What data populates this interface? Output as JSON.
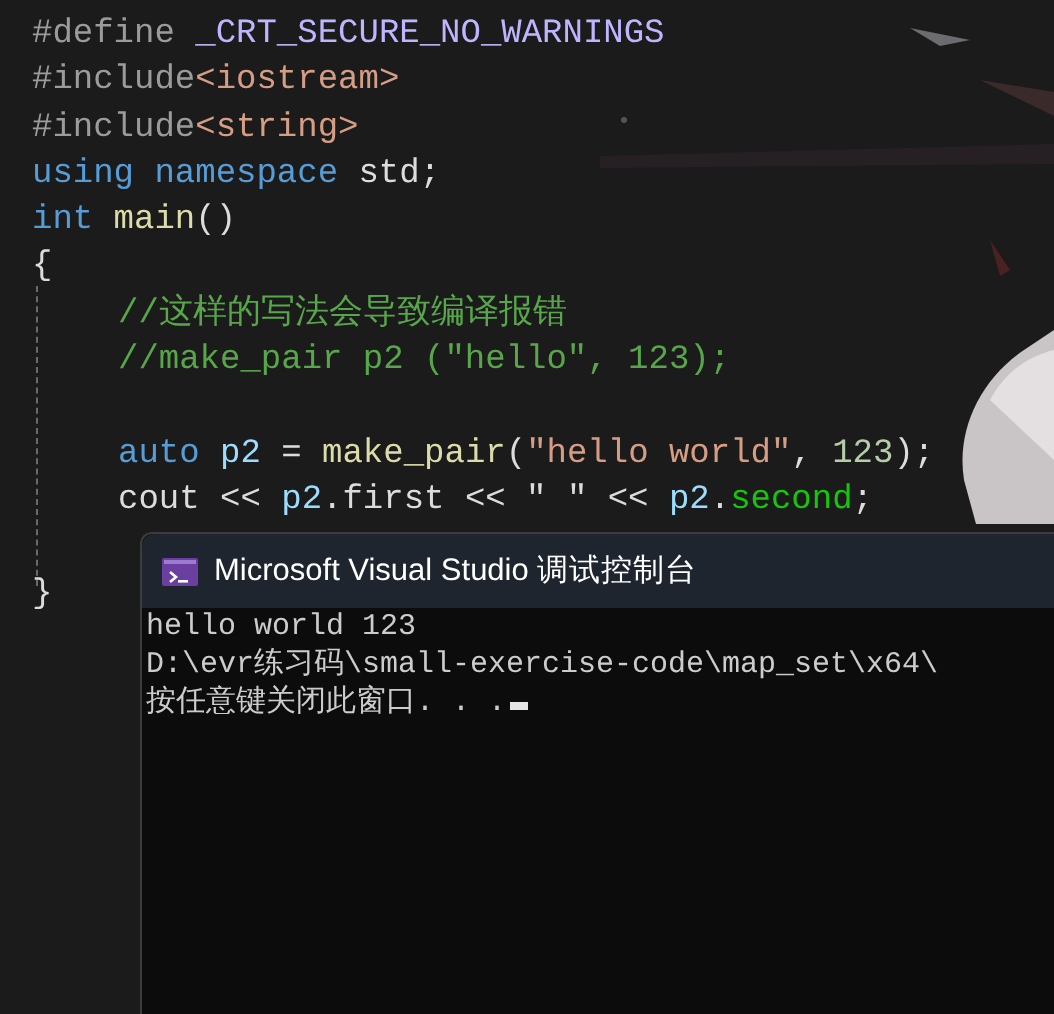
{
  "editor": {
    "lines": [
      {
        "kind": "code",
        "tokens": [
          {
            "kind": "preprocessor",
            "text": "#define "
          },
          {
            "kind": "macro",
            "text": "_CRT_SECURE_NO_WARNINGS"
          }
        ]
      },
      {
        "kind": "code",
        "tokens": [
          {
            "kind": "preprocessor",
            "text": "#include"
          },
          {
            "kind": "string",
            "text": "<iostream>"
          }
        ]
      },
      {
        "kind": "code",
        "tokens": [
          {
            "kind": "preprocessor",
            "text": "#include"
          },
          {
            "kind": "string",
            "text": "<string>"
          }
        ]
      },
      {
        "kind": "code",
        "tokens": [
          {
            "kind": "keyword",
            "text": "using namespace"
          },
          {
            "kind": "plain",
            "text": " std;"
          }
        ]
      },
      {
        "kind": "code",
        "tokens": [
          {
            "kind": "keyword",
            "text": "int"
          },
          {
            "kind": "function",
            "text": " main"
          },
          {
            "kind": "plain",
            "text": "()"
          }
        ]
      },
      {
        "kind": "code",
        "tokens": [
          {
            "kind": "plain",
            "text": "{"
          }
        ]
      },
      {
        "kind": "indented",
        "tokens": [
          {
            "kind": "comment",
            "text": "//这样的写法会导致编译报错"
          }
        ]
      },
      {
        "kind": "indented",
        "tokens": [
          {
            "kind": "comment",
            "text": "//make_pair p2 (\"hello\", 123);"
          }
        ]
      },
      {
        "kind": "blank"
      },
      {
        "kind": "indented",
        "tokens": [
          {
            "kind": "keyword",
            "text": "auto"
          },
          {
            "kind": "variable",
            "text": " p2"
          },
          {
            "kind": "plain",
            "text": " = "
          },
          {
            "kind": "function",
            "text": "make_pair"
          },
          {
            "kind": "plain",
            "text": "("
          },
          {
            "kind": "string",
            "text": "\"hello world\""
          },
          {
            "kind": "plain",
            "text": ", "
          },
          {
            "kind": "number",
            "text": "123"
          },
          {
            "kind": "plain",
            "text": ");"
          }
        ]
      },
      {
        "kind": "indented",
        "tokens": [
          {
            "kind": "plain",
            "text": "cout << "
          },
          {
            "kind": "variable",
            "text": "p2"
          },
          {
            "kind": "plain",
            "text": ".first << \" \" << "
          },
          {
            "kind": "variable",
            "text": "p2"
          },
          {
            "kind": "plain",
            "text": "."
          },
          {
            "kind": "member",
            "text": "second"
          },
          {
            "kind": "plain",
            "text": ";"
          }
        ]
      },
      {
        "kind": "blank"
      },
      {
        "kind": "code",
        "tokens": [
          {
            "kind": "plain",
            "text": "}"
          }
        ]
      }
    ]
  },
  "console": {
    "title": "Microsoft Visual Studio 调试控制台",
    "lines": [
      "hello world 123",
      "D:\\evr练习码\\small-exercise-code\\map_set\\x64\\",
      "按任意键关闭此窗口. . ."
    ]
  }
}
